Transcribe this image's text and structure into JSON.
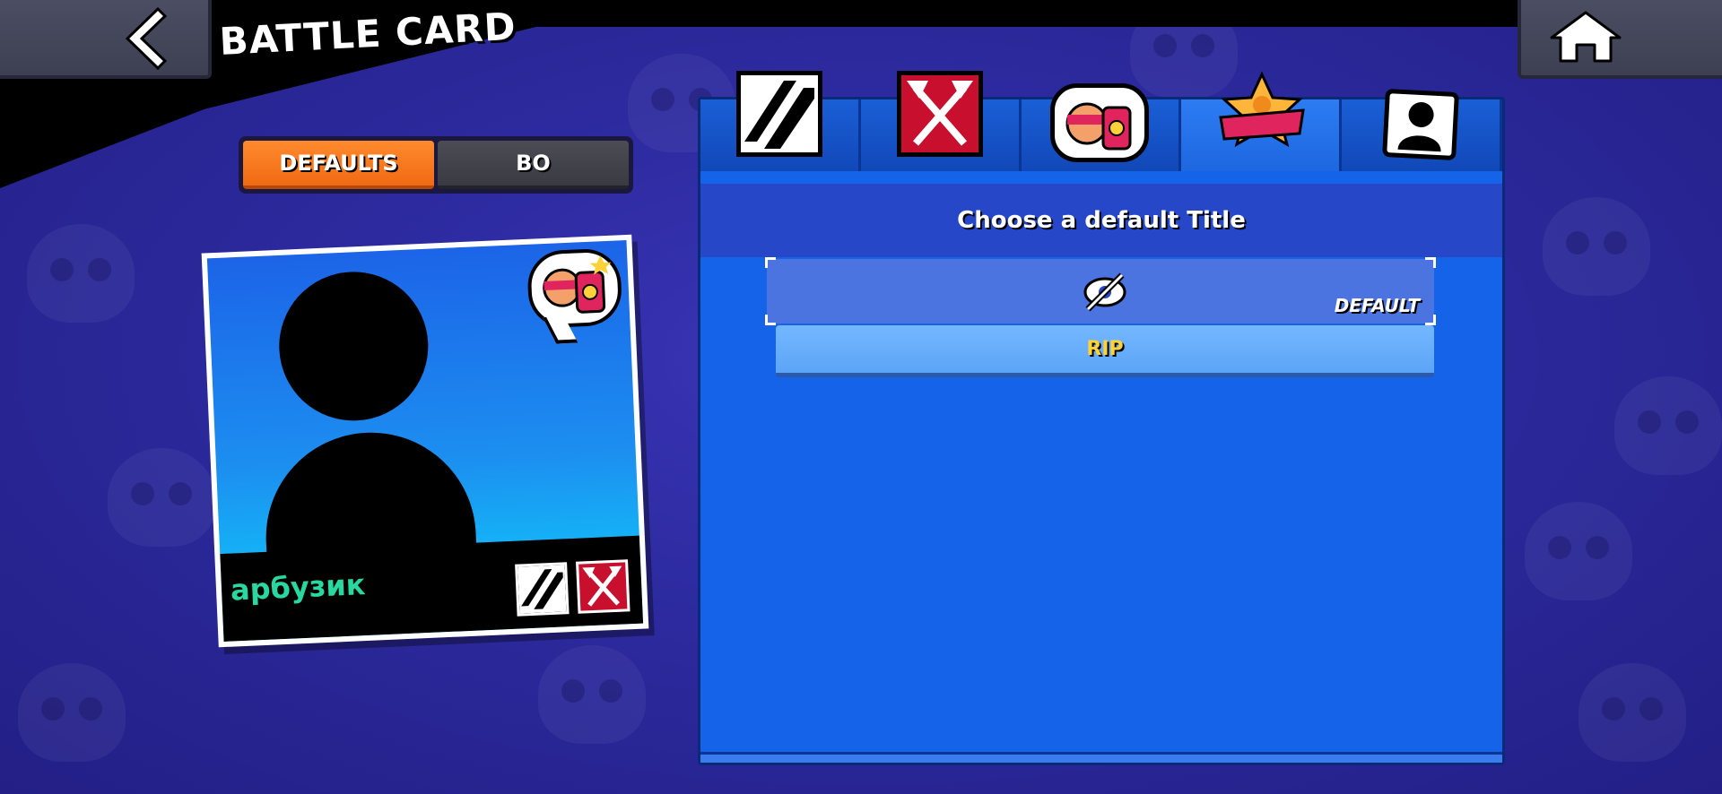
{
  "header": {
    "title": "BATTLE CARD",
    "back_icon": "chevron-left-icon",
    "home_icon": "home-icon"
  },
  "toggle": {
    "options": [
      {
        "label": "DEFAULTS",
        "active": true
      },
      {
        "label": "BO",
        "active": false
      }
    ]
  },
  "battle_card": {
    "player_name": "арбузик",
    "name_color": "#28d8a0",
    "portrait_icon": "player-silhouette-icon",
    "pin_icon": "brawler-pin-icon",
    "badges": [
      "stripes-badge-icon",
      "crossed-axes-badge-icon"
    ]
  },
  "panel": {
    "tabs": [
      {
        "icon": "stripes-icon",
        "active": false
      },
      {
        "icon": "crossed-axes-icon",
        "active": false
      },
      {
        "icon": "brawler-pin-icon",
        "active": false
      },
      {
        "icon": "title-banner-icon",
        "active": true
      },
      {
        "icon": "profile-silhouette-icon",
        "active": false
      }
    ],
    "header": "Choose a default Title",
    "default_row": {
      "icon": "eye-hidden-icon",
      "tag": "DEFAULT"
    },
    "options": [
      {
        "label": "RIP"
      }
    ]
  },
  "colors": {
    "accent_orange": "#f06a14",
    "panel_blue": "#1563e8",
    "title_yellow": "#ffd23a"
  }
}
